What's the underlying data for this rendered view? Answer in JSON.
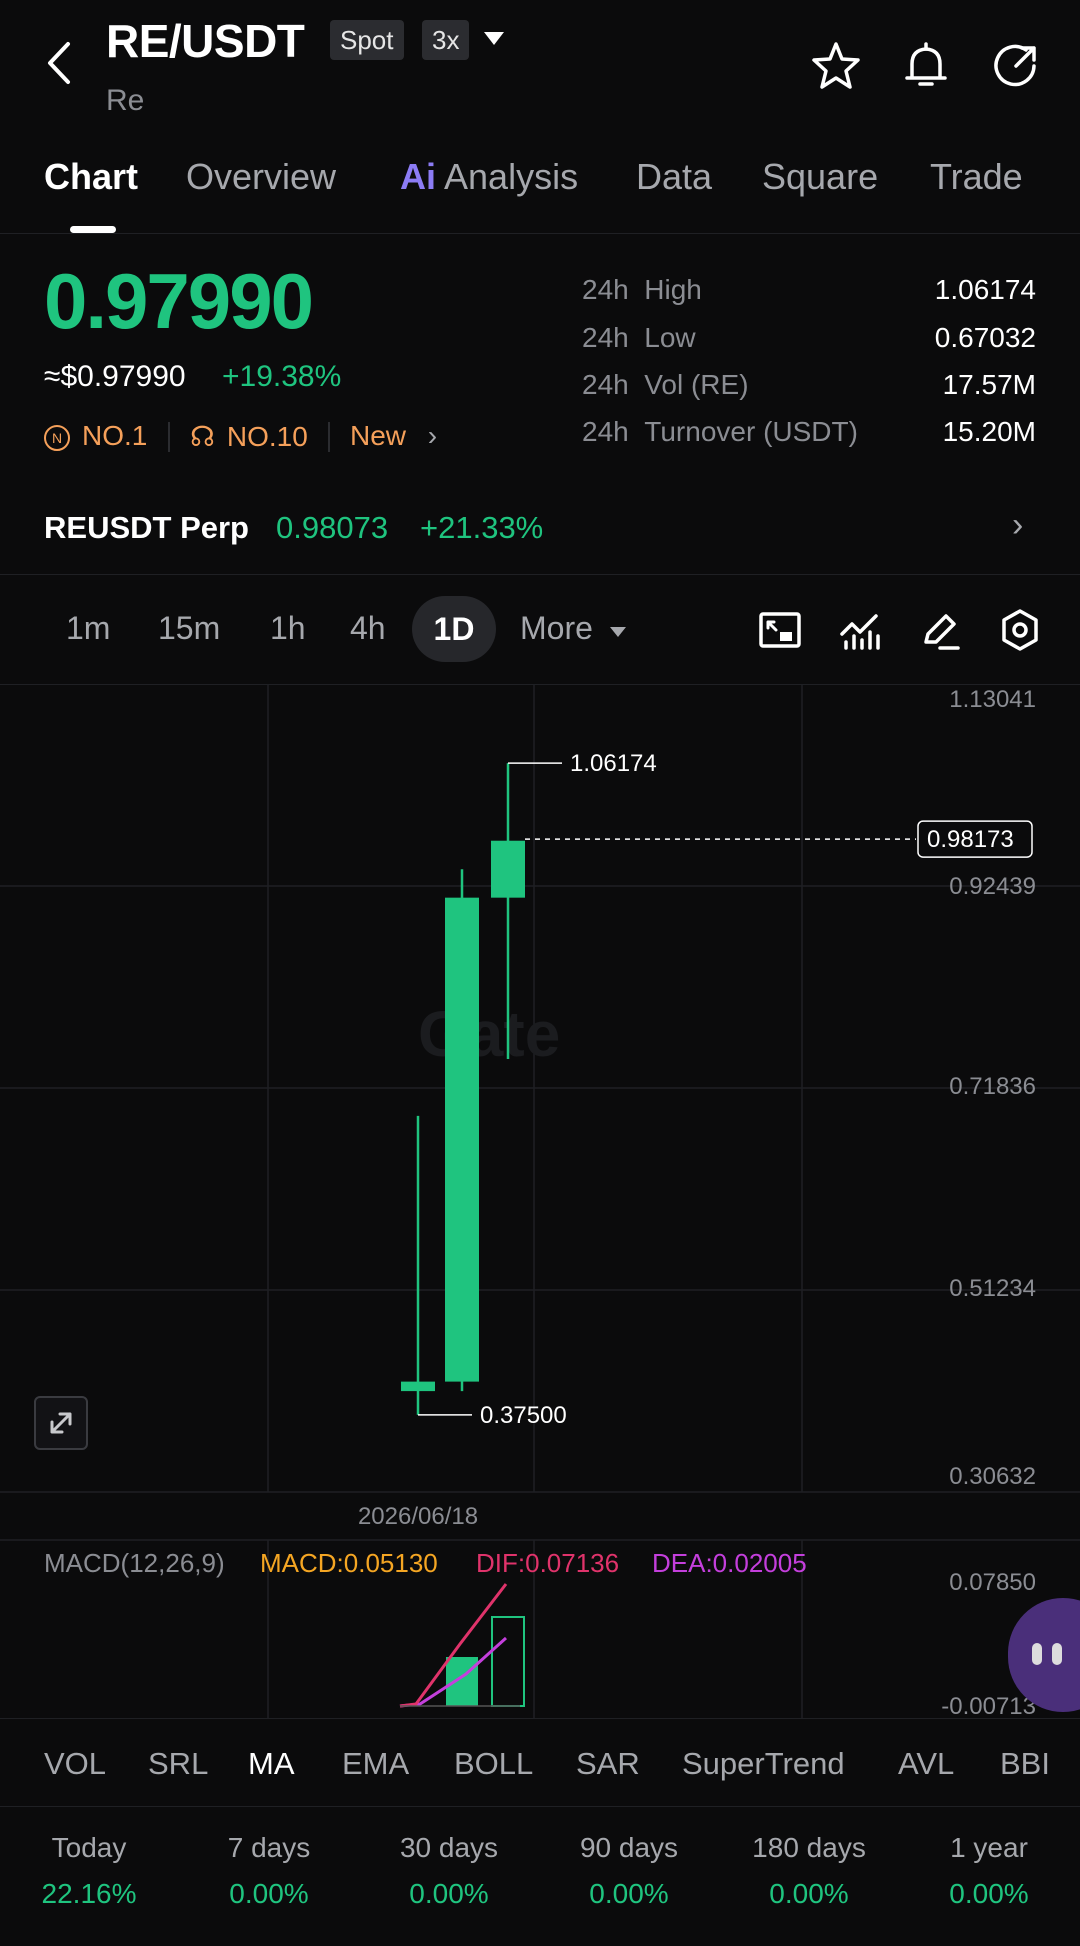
{
  "header": {
    "pair": "RE/USDT",
    "market_tag": "Spot",
    "leverage_tag": "3x",
    "subname": "Re"
  },
  "tabs": [
    {
      "label": "Chart",
      "active": true
    },
    {
      "label": "Overview"
    },
    {
      "label": "Analysis",
      "prefix": "Ai"
    },
    {
      "label": "Data"
    },
    {
      "label": "Square"
    },
    {
      "label": "Trade"
    }
  ],
  "price": {
    "last": "0.97990",
    "usd": "≈$0.97990",
    "change": "+19.38%",
    "ranks": [
      "NO.1",
      "NO.10",
      "New"
    ]
  },
  "stats": [
    {
      "period": "24h",
      "label": "High",
      "value": "1.06174"
    },
    {
      "period": "24h",
      "label": "Low",
      "value": "0.67032"
    },
    {
      "period": "24h",
      "label": "Vol (RE)",
      "value": "17.57M"
    },
    {
      "period": "24h",
      "label": "Turnover (USDT)",
      "value": "15.20M"
    }
  ],
  "perp": {
    "name": "REUSDT Perp",
    "price": "0.98073",
    "change": "+21.33%"
  },
  "intervals": [
    "1m",
    "15m",
    "1h",
    "4h",
    "1D",
    "More"
  ],
  "chart": {
    "y_ticks": [
      "1.13041",
      "0.92439",
      "0.71836",
      "0.51234",
      "0.30632"
    ],
    "high_label": "1.06174",
    "low_label": "0.37500",
    "last_price_tag": "0.98173",
    "date_label": "2026/06/18",
    "watermark": "Gate"
  },
  "macd": {
    "title": "MACD(12,26,9)",
    "macd": "MACD:0.05130",
    "dif": "DIF:0.07136",
    "dea": "DEA:0.02005",
    "y_top": "0.07850",
    "y_bottom": "-0.00713"
  },
  "indicators": [
    "VOL",
    "SRL",
    "MA",
    "EMA",
    "BOLL",
    "SAR",
    "SuperTrend",
    "AVL",
    "BBI"
  ],
  "performance": [
    {
      "label": "Today",
      "value": "22.16%"
    },
    {
      "label": "7 days",
      "value": "0.00%"
    },
    {
      "label": "30 days",
      "value": "0.00%"
    },
    {
      "label": "90 days",
      "value": "0.00%"
    },
    {
      "label": "180 days",
      "value": "0.00%"
    },
    {
      "label": "1 year",
      "value": "0.00%"
    }
  ],
  "chart_data": {
    "type": "candlestick",
    "candles": [
      {
        "open": 0.4,
        "high": 0.69,
        "low": 0.375,
        "close": 0.41
      },
      {
        "open": 0.41,
        "high": 0.95,
        "low": 0.4,
        "close": 0.92
      },
      {
        "open": 0.92,
        "high": 1.06174,
        "low": 0.75,
        "close": 0.98
      }
    ],
    "ylim": [
      0.30632,
      1.13041
    ],
    "last_price": 0.98173,
    "x_label": "2026/06/18",
    "colors": {
      "up": "#1fc47f"
    }
  }
}
